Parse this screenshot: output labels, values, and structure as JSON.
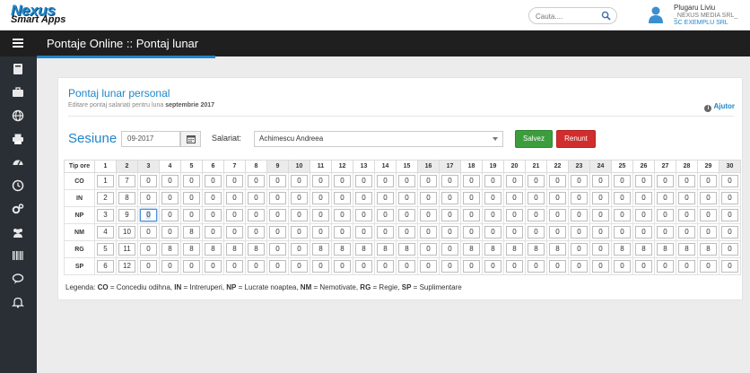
{
  "header": {
    "logo_main": "Nexus",
    "logo_sub": "Smart Apps",
    "search_placeholder": "Cauta....",
    "user_name": "Plugaru Liviu",
    "user_company1": "_NEXUS MEDIA SRL_",
    "user_company2": "SC EXEMPLU SRL"
  },
  "title_bar": {
    "title": "Pontaje Online :: Pontaj lunar"
  },
  "sidebar": {
    "items": [
      "book",
      "briefcase",
      "globe",
      "print",
      "dashboard",
      "clock",
      "gears",
      "users",
      "barcode",
      "comments",
      "bell"
    ]
  },
  "panel": {
    "title": "Pontaj lunar personal",
    "subtitle_prefix": "Editare pontaj salariați pentru luna",
    "subtitle_month": "septembrie 2017",
    "help": "Ajutor"
  },
  "form": {
    "session_label": "Sesiune",
    "session_value": "09-2017",
    "employee_label": "Salariat:",
    "employee_value": "Achimescu Andreea",
    "save_label": "Salvez",
    "cancel_label": "Renunt"
  },
  "grid": {
    "corner": "Tip ore",
    "days": [
      "1",
      "2",
      "3",
      "4",
      "5",
      "6",
      "7",
      "8",
      "9",
      "10",
      "11",
      "12",
      "13",
      "14",
      "15",
      "16",
      "17",
      "18",
      "19",
      "20",
      "21",
      "22",
      "23",
      "24",
      "25",
      "26",
      "27",
      "28",
      "29",
      "30"
    ],
    "weekend_days": [
      "2",
      "3",
      "9",
      "10",
      "16",
      "17",
      "23",
      "24",
      "30"
    ],
    "rows": [
      {
        "label": "CO",
        "values": [
          "1",
          "7",
          "0",
          "0",
          "0",
          "0",
          "0",
          "0",
          "0",
          "0",
          "0",
          "0",
          "0",
          "0",
          "0",
          "0",
          "0",
          "0",
          "0",
          "0",
          "0",
          "0",
          "0",
          "0",
          "0",
          "0",
          "0",
          "0",
          "0",
          "0"
        ]
      },
      {
        "label": "IN",
        "values": [
          "2",
          "8",
          "0",
          "0",
          "0",
          "0",
          "0",
          "0",
          "0",
          "0",
          "0",
          "0",
          "0",
          "0",
          "0",
          "0",
          "0",
          "0",
          "0",
          "0",
          "0",
          "0",
          "0",
          "0",
          "0",
          "0",
          "0",
          "0",
          "0",
          "0"
        ]
      },
      {
        "label": "NP",
        "values": [
          "3",
          "9",
          "0",
          "0",
          "0",
          "0",
          "0",
          "0",
          "0",
          "0",
          "0",
          "0",
          "0",
          "0",
          "0",
          "0",
          "0",
          "0",
          "0",
          "0",
          "0",
          "0",
          "0",
          "0",
          "0",
          "0",
          "0",
          "0",
          "0",
          "0"
        ]
      },
      {
        "label": "NM",
        "values": [
          "4",
          "10",
          "0",
          "0",
          "8",
          "0",
          "0",
          "0",
          "0",
          "0",
          "0",
          "0",
          "0",
          "0",
          "0",
          "0",
          "0",
          "0",
          "0",
          "0",
          "0",
          "0",
          "0",
          "0",
          "0",
          "0",
          "0",
          "0",
          "0",
          "0"
        ]
      },
      {
        "label": "RG",
        "values": [
          "5",
          "11",
          "0",
          "8",
          "8",
          "8",
          "8",
          "8",
          "0",
          "0",
          "8",
          "8",
          "8",
          "8",
          "8",
          "0",
          "0",
          "8",
          "8",
          "8",
          "8",
          "8",
          "0",
          "0",
          "8",
          "8",
          "8",
          "8",
          "8",
          "0"
        ]
      },
      {
        "label": "SP",
        "values": [
          "6",
          "12",
          "0",
          "0",
          "0",
          "0",
          "0",
          "0",
          "0",
          "0",
          "0",
          "0",
          "0",
          "0",
          "0",
          "0",
          "0",
          "0",
          "0",
          "0",
          "0",
          "0",
          "0",
          "0",
          "0",
          "0",
          "0",
          "0",
          "0",
          "0"
        ]
      }
    ],
    "selected_cell": {
      "row": 2,
      "col": 2
    }
  },
  "legend": {
    "prefix": "Legenda: ",
    "items": [
      {
        "code": "CO",
        "desc": "Concediu odihna"
      },
      {
        "code": "IN",
        "desc": "Intreruperi"
      },
      {
        "code": "NP",
        "desc": "Lucrate noaptea"
      },
      {
        "code": "NM",
        "desc": "Nemotivate"
      },
      {
        "code": "RG",
        "desc": "Regie"
      },
      {
        "code": "SP",
        "desc": "Suplimentare"
      }
    ]
  },
  "colors": {
    "accent": "#1f86c8",
    "sidebar": "#2a2f36",
    "titlebar": "#1f1f1f",
    "save": "#3c9d3c",
    "cancel": "#d12d2d"
  }
}
